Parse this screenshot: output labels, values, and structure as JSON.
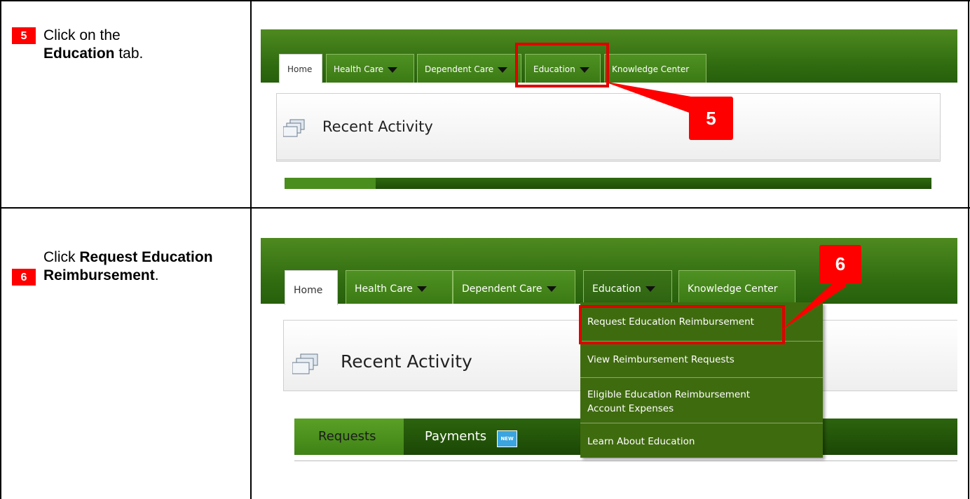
{
  "steps": [
    {
      "number": "5",
      "text_pre": "Click on the ",
      "text_bold": "Education",
      "text_post": " tab."
    },
    {
      "number": "6",
      "text_pre": "Click ",
      "text_bold": "Request Education Reimbursement",
      "text_post": "."
    }
  ],
  "nav": {
    "home": "Home",
    "health_care": "Health Care",
    "dependent_care": "Dependent Care",
    "education": "Education",
    "knowledge_center": "Knowledge Center"
  },
  "panel_title": "Recent Activity",
  "callouts": {
    "first": "5",
    "second": "6"
  },
  "education_menu": [
    "Request Education Reimbursement",
    "View Reimbursement Requests",
    "Eligible Education Reimbursement Account Expenses",
    "Learn About Education"
  ],
  "subtabs": {
    "requests": "Requests",
    "payments": "Payments",
    "new_badge": "NEW"
  },
  "colors": {
    "accent_red": "#ff0000",
    "nav_green": "#3b7a14"
  }
}
